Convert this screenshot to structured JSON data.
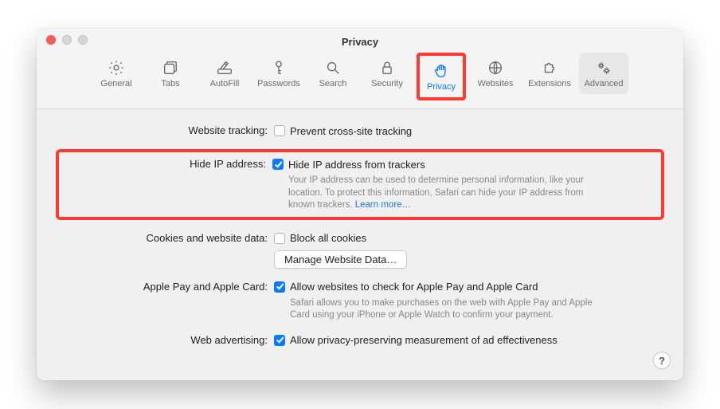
{
  "window": {
    "title": "Privacy"
  },
  "toolbar": {
    "general": "General",
    "tabs": "Tabs",
    "autofill": "AutoFill",
    "passwords": "Passwords",
    "search": "Search",
    "security": "Security",
    "privacy": "Privacy",
    "websites": "Websites",
    "extensions": "Extensions",
    "advanced": "Advanced"
  },
  "labels": {
    "website_tracking": "Website tracking:",
    "hide_ip": "Hide IP address:",
    "cookies": "Cookies and website data:",
    "apple_pay": "Apple Pay and Apple Card:",
    "web_ads": "Web advertising:"
  },
  "fields": {
    "prevent_cross": "Prevent cross-site tracking",
    "hide_ip_label": "Hide IP address from trackers",
    "hide_ip_desc": "Your IP address can be used to determine personal information, like your location. To protect this information, Safari can hide your IP address from known trackers. ",
    "learn_more": "Learn more…",
    "block_cookies": "Block all cookies",
    "manage_btn": "Manage Website Data…",
    "apple_pay_label": "Allow websites to check for Apple Pay and Apple Card",
    "apple_pay_desc": "Safari allows you to make purchases on the web with Apple Pay and Apple Card using your iPhone or Apple Watch to confirm your payment.",
    "web_ads_label": "Allow privacy-preserving measurement of ad effectiveness"
  },
  "help": "?"
}
